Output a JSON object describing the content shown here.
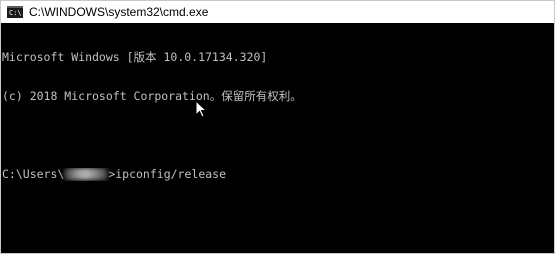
{
  "window": {
    "icon_text": "C:\\",
    "title": "C:\\WINDOWS\\system32\\cmd.exe"
  },
  "console": {
    "line1": "Microsoft Windows [版本 10.0.17134.320]",
    "line2": "(c) 2018 Microsoft Corporation。保留所有权利。",
    "prompt_prefix": "C:\\Users\\",
    "prompt_suffix": ">ipconfig/release"
  },
  "icons": {
    "app": "cmd-terminal-icon",
    "pointer": "mouse-pointer-icon"
  }
}
